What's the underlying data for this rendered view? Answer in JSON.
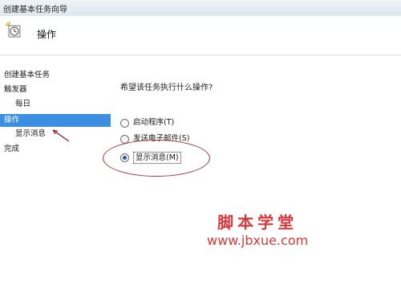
{
  "window": {
    "title": "创建基本任务向导"
  },
  "header": {
    "title": "操作",
    "icon": "task-clock-icon"
  },
  "sidebar": {
    "items": [
      {
        "label": "创建基本任务",
        "level": 0,
        "selected": false
      },
      {
        "label": "触发器",
        "level": 0,
        "selected": false
      },
      {
        "label": "每日",
        "level": 1,
        "selected": false
      },
      {
        "label": "操作",
        "level": 0,
        "selected": true
      },
      {
        "label": "显示消息",
        "level": 1,
        "selected": false
      },
      {
        "label": "完成",
        "level": 0,
        "selected": false
      }
    ]
  },
  "main": {
    "question": "希望该任务执行什么操作?",
    "options": [
      {
        "label": "启动程序(T)",
        "checked": false
      },
      {
        "label": "发送电子邮件(S)",
        "checked": false
      },
      {
        "label": "显示消息(M)",
        "checked": true
      }
    ]
  },
  "watermark": {
    "cn": "脚本学堂",
    "url": "www.jbxue.com"
  },
  "colors": {
    "selection": "#3c8fe0",
    "annotation": "#a33b3b",
    "watermark": "#d9383a"
  }
}
